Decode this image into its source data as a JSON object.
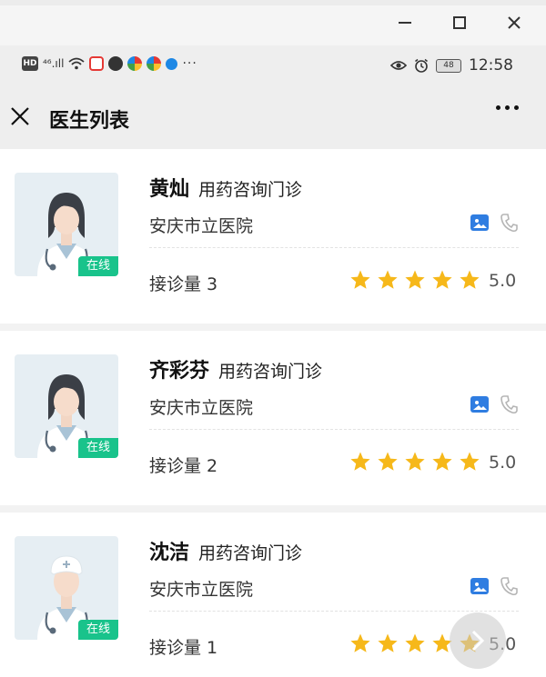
{
  "status_bar": {
    "hd": "HD",
    "signal": "⁴⁶.ıll",
    "battery": "48",
    "time": "12:58"
  },
  "header": {
    "title": "医生列表"
  },
  "doctors": [
    {
      "name": "黄灿",
      "department": "用药咨询门诊",
      "hospital": "安庆市立医院",
      "consult_label": "接诊量 3",
      "rating": "5.0",
      "stars": 5,
      "status": "在线",
      "avatar": "female-doctor"
    },
    {
      "name": "齐彩芬",
      "department": "用药咨询门诊",
      "hospital": "安庆市立医院",
      "consult_label": "接诊量 2",
      "rating": "5.0",
      "stars": 5,
      "status": "在线",
      "avatar": "female-doctor"
    },
    {
      "name": "沈洁",
      "department": "用药咨询门诊",
      "hospital": "安庆市立医院",
      "consult_label": "接诊量 1",
      "rating": "5.0",
      "stars": 5,
      "status": "在线",
      "avatar": "nurse"
    }
  ],
  "colors": {
    "online": "#19c38b",
    "star": "#f6b81a",
    "image_icon": "#2f7de1"
  }
}
